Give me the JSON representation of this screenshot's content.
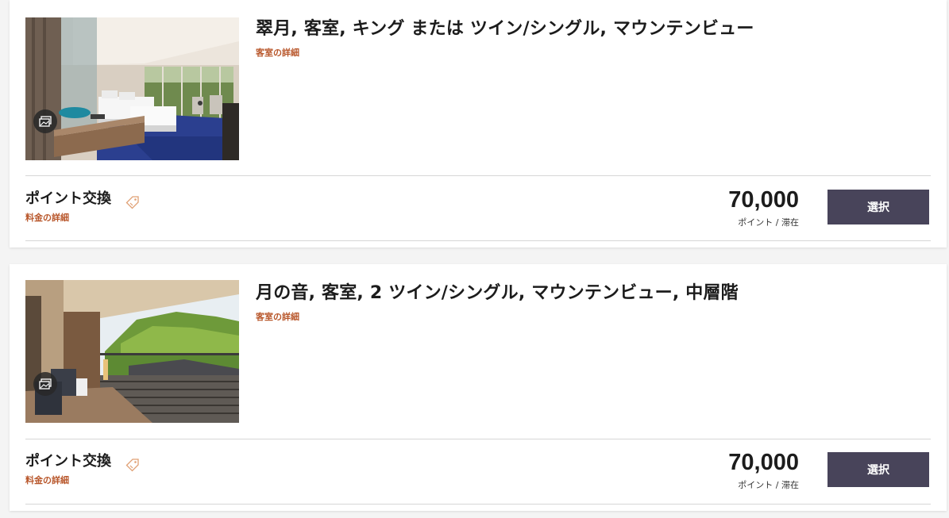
{
  "rooms": [
    {
      "title": "翠月, 客室, キング または ツイン/シングル, マウンテンビュー",
      "room_details_label": "客室の詳細",
      "rate_name": "ポイント交換",
      "rate_details_label": "料金の詳細",
      "price": "70,000",
      "price_unit": "ポイント / 滞在",
      "select_label": "選択"
    },
    {
      "title": "月の音, 客室, 2 ツイン/シングル, マウンテンビュー, 中層階",
      "room_details_label": "客室の詳細",
      "rate_name": "ポイント交換",
      "rate_details_label": "料金の詳細",
      "price": "70,000",
      "price_unit": "ポイント / 滞在",
      "select_label": "選択"
    }
  ],
  "colors": {
    "accent_link": "#b8562a",
    "button_bg": "#48445a",
    "button_text": "#ffffff",
    "page_bg": "#f4f4f4"
  },
  "icons": {
    "gallery": "photo-gallery-icon",
    "tag": "price-tag-icon"
  }
}
